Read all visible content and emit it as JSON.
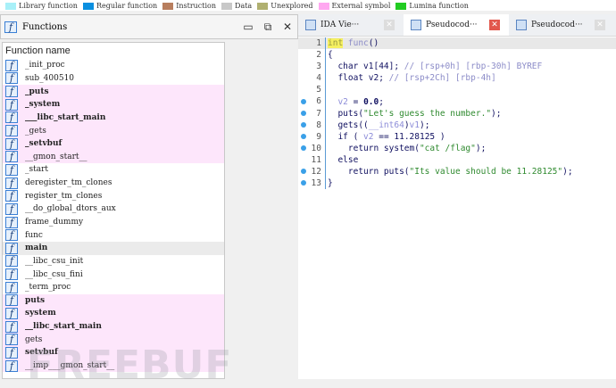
{
  "legend": [
    {
      "label": "Library function",
      "color": "#a8f0f8"
    },
    {
      "label": "Regular function",
      "color": "#0a8fe0"
    },
    {
      "label": "Instruction",
      "color": "#b87e5e"
    },
    {
      "label": "Data",
      "color": "#c8c8c8"
    },
    {
      "label": "Unexplored",
      "color": "#b0b070"
    },
    {
      "label": "External symbol",
      "color": "#ffa8f0"
    },
    {
      "label": "Lumina function",
      "color": "#22cc22"
    }
  ],
  "functions_panel": {
    "title": "Functions",
    "column_header": "Function name",
    "items": [
      {
        "name": "_init_proc",
        "type": "regular"
      },
      {
        "name": "sub_400510",
        "type": "regular"
      },
      {
        "name": "_puts",
        "type": "external",
        "bold": true
      },
      {
        "name": "_system",
        "type": "external",
        "bold": true
      },
      {
        "name": "___libc_start_main",
        "type": "external",
        "bold": true
      },
      {
        "name": "_gets",
        "type": "external"
      },
      {
        "name": "_setvbuf",
        "type": "external",
        "bold": true
      },
      {
        "name": "__gmon_start__",
        "type": "external"
      },
      {
        "name": "_start",
        "type": "regular"
      },
      {
        "name": "deregister_tm_clones",
        "type": "regular"
      },
      {
        "name": "register_tm_clones",
        "type": "regular"
      },
      {
        "name": "__do_global_dtors_aux",
        "type": "regular"
      },
      {
        "name": "frame_dummy",
        "type": "regular"
      },
      {
        "name": "func",
        "type": "regular"
      },
      {
        "name": "main",
        "type": "selected",
        "bold": true
      },
      {
        "name": "__libc_csu_init",
        "type": "regular"
      },
      {
        "name": "__libc_csu_fini",
        "type": "regular"
      },
      {
        "name": "_term_proc",
        "type": "regular"
      },
      {
        "name": "puts",
        "type": "external",
        "bold": true
      },
      {
        "name": "system",
        "type": "external",
        "bold": true
      },
      {
        "name": "__libc_start_main",
        "type": "external",
        "bold": true
      },
      {
        "name": "gets",
        "type": "external"
      },
      {
        "name": "setvbuf",
        "type": "external",
        "bold": true
      },
      {
        "name": "__imp___gmon_start__",
        "type": "external"
      }
    ]
  },
  "watermark": "FREEBUF",
  "tabs": [
    {
      "label": "IDA Vie···",
      "active": false
    },
    {
      "label": "Pseudocod···",
      "active": true
    },
    {
      "label": "Pseudocod···",
      "active": false
    }
  ],
  "code": [
    {
      "n": "1",
      "bp": false,
      "cur": true,
      "t": [
        [
          "hl",
          "int"
        ],
        [
          "cm",
          " func"
        ],
        [
          "kw",
          "()"
        ]
      ]
    },
    {
      "n": "2",
      "bp": false,
      "t": [
        [
          "kw",
          "{"
        ]
      ]
    },
    {
      "n": "3",
      "bp": false,
      "t": [
        [
          "kw",
          "  char v1[44]; "
        ],
        [
          "cm",
          "// [rsp+0h] [rbp-30h] BYREF"
        ]
      ]
    },
    {
      "n": "4",
      "bp": false,
      "t": [
        [
          "kw",
          "  float v2; "
        ],
        [
          "cm",
          "// [rsp+2Ch] [rbp-4h]"
        ]
      ]
    },
    {
      "n": "5",
      "bp": false,
      "t": []
    },
    {
      "n": "6",
      "bp": true,
      "t": [
        [
          "vr",
          "  v2"
        ],
        [
          "kw",
          " = "
        ],
        [
          "nm2",
          "0.0"
        ],
        [
          "kw",
          ";"
        ]
      ]
    },
    {
      "n": "7",
      "bp": true,
      "t": [
        [
          "kw",
          "  puts("
        ],
        [
          "st",
          "\"Let's guess the number.\""
        ],
        [
          "kw",
          ");"
        ]
      ]
    },
    {
      "n": "8",
      "bp": true,
      "t": [
        [
          "kw",
          "  gets(("
        ],
        [
          "vr",
          "__int64"
        ],
        [
          "kw",
          ")"
        ],
        [
          "vr",
          "v1"
        ],
        [
          "kw",
          ");"
        ]
      ]
    },
    {
      "n": "9",
      "bp": true,
      "t": [
        [
          "kw",
          "  if ( "
        ],
        [
          "vr",
          "v2"
        ],
        [
          "kw",
          " == 11.28125 )"
        ]
      ]
    },
    {
      "n": "10",
      "bp": true,
      "t": [
        [
          "kw",
          "    return system("
        ],
        [
          "st",
          "\"cat /flag\""
        ],
        [
          "kw",
          ");"
        ]
      ]
    },
    {
      "n": "11",
      "bp": false,
      "t": [
        [
          "kw",
          "  else"
        ]
      ]
    },
    {
      "n": "12",
      "bp": true,
      "t": [
        [
          "kw",
          "    return puts("
        ],
        [
          "st",
          "\"Its value should be 11.28125\""
        ],
        [
          "kw",
          ");"
        ]
      ]
    },
    {
      "n": "13",
      "bp": true,
      "t": [
        [
          "kw",
          "}"
        ]
      ]
    }
  ]
}
